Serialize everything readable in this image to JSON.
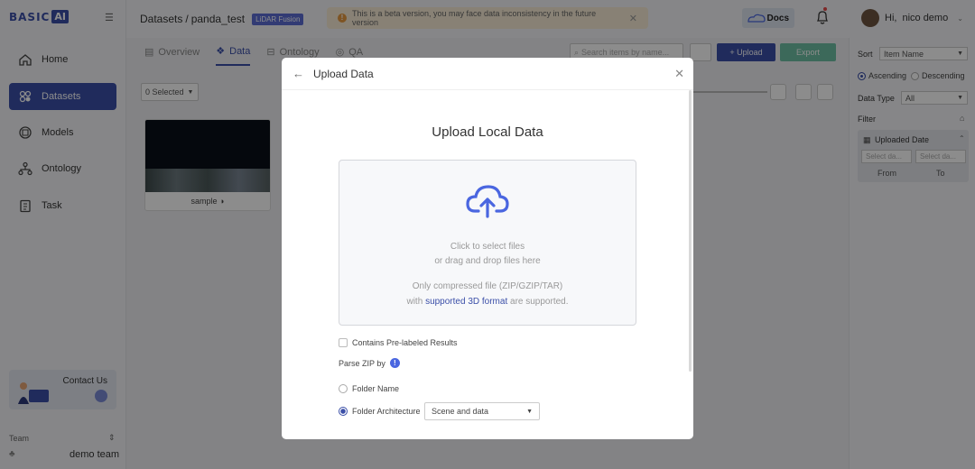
{
  "app": {
    "logo_text": "BASIC",
    "logo_box": "AI"
  },
  "sidebar": {
    "items": [
      {
        "label": "Home"
      },
      {
        "label": "Datasets"
      },
      {
        "label": "Models"
      },
      {
        "label": "Ontology"
      },
      {
        "label": "Task"
      }
    ],
    "contact": "Contact Us",
    "team_label": "Team",
    "team_name": "demo team"
  },
  "header": {
    "breadcrumb_root": "Datasets",
    "breadcrumb_sep": "/",
    "breadcrumb_current": "panda_test",
    "tag": "LiDAR Fusion",
    "beta_msg": "This is a beta version, you may face data inconsistency in the future version",
    "docs": "Docs",
    "greeting": "Hi,",
    "user": "nico demo"
  },
  "main": {
    "tabs": [
      {
        "label": "Overview"
      },
      {
        "label": "Data"
      },
      {
        "label": "Ontology"
      },
      {
        "label": "QA"
      }
    ],
    "search_placeholder": "Search items by name...",
    "upload": "+ Upload",
    "export": "Export",
    "selected": "0 Selected",
    "card_name": "sample"
  },
  "filters": {
    "sort_label": "Sort",
    "sort_value": "Item Name",
    "ascending": "Ascending",
    "descending": "Descending",
    "data_type_label": "Data Type",
    "data_type_value": "All",
    "filter_label": "Filter",
    "uploaded_date": "Uploaded Date",
    "from_placeholder": "Select da...",
    "to_placeholder": "Select da...",
    "from_label": "From",
    "to_label": "To"
  },
  "modal": {
    "title": "Upload Data",
    "heading": "Upload Local Data",
    "click_select": "Click to select files",
    "drag_drop": "or drag and drop files here",
    "only_compressed": "Only compressed file (ZIP/GZIP/TAR)",
    "with_text": "with",
    "link_text": "supported 3D format",
    "supported_suffix": "are supported.",
    "prelabeled": "Contains Pre-labeled Results",
    "parse_label": "Parse ZIP by",
    "opt_folder_name": "Folder Name",
    "opt_folder_arch": "Folder Architecture",
    "arch_value": "Scene and data"
  },
  "colors": {
    "primary": "#3b4fa8",
    "export": "#6dc0a4",
    "beta_bg": "#f7ecd6"
  }
}
